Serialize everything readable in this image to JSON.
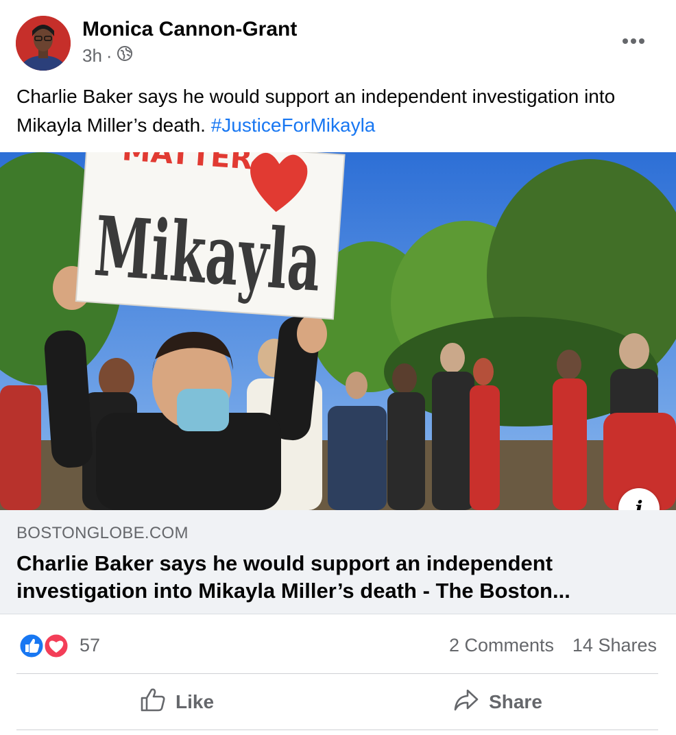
{
  "post": {
    "author": "Monica Cannon-Grant",
    "time": "3h",
    "separator": "·",
    "text_main": "Charlie Baker says he would support an independent investigation into Mikayla Miller’s death. ",
    "hashtag": "#JusticeForMikayla",
    "image_sign_text": "Mikayla",
    "image_sign_top_text": "MATTER"
  },
  "link_preview": {
    "domain": "BOSTONGLOBE.COM",
    "title": "Charlie Baker says he would support an independent investigation into Mikayla Miller’s death - The Boston..."
  },
  "stats": {
    "reactions": "57",
    "comments": "2 Comments",
    "shares": "14 Shares"
  },
  "actions": {
    "like_label": "Like",
    "share_label": "Share"
  },
  "icons": {
    "globe": "globe-icon",
    "more": "more-horizontal-icon",
    "info": "info-icon",
    "like_reaction": "like-reaction-icon",
    "love_reaction": "love-reaction-icon",
    "like_action": "thumbs-up-icon",
    "share_action": "share-arrow-icon"
  },
  "colors": {
    "link_blue": "#1877f2",
    "secondary_text": "#65676b",
    "love_red": "#f33e58"
  }
}
